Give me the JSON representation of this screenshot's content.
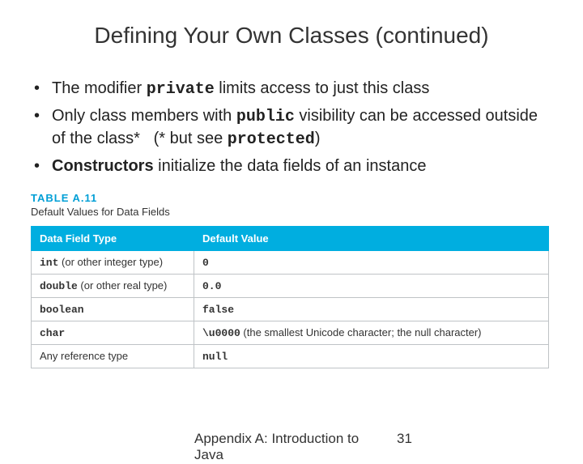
{
  "title": "Defining Your Own Classes (continued)",
  "bullets": {
    "b1a": "The modifier ",
    "b1code": "private",
    "b1b": " limits access to just this class",
    "b2a": "Only class members with ",
    "b2code1": "public",
    "b2b": " visibility can be accessed outside of the class*   (* but see ",
    "b2code2": "protected",
    "b2c": ")",
    "b3bold": "Constructors",
    "b3rest": " initialize the data fields of an instance"
  },
  "table": {
    "label": "TABLE A.11",
    "caption": "Default Values for Data Fields",
    "headers": [
      "Data Field Type",
      "Default Value"
    ],
    "rows": [
      {
        "type_mono": "int",
        "type_rest": " (or other integer type)",
        "value_mono": "0",
        "value_rest": ""
      },
      {
        "type_mono": "double",
        "type_rest": " (or other real type)",
        "value_mono": "0.0",
        "value_rest": ""
      },
      {
        "type_mono": "boolean",
        "type_rest": "",
        "value_mono": "false",
        "value_rest": ""
      },
      {
        "type_mono": "char",
        "type_rest": "",
        "value_mono": "\\u0000",
        "value_rest": " (the smallest Unicode character; the null character)"
      },
      {
        "type_mono": "",
        "type_rest": "Any reference type",
        "value_mono": "null",
        "value_rest": ""
      }
    ]
  },
  "footer": {
    "text": "Appendix A: Introduction to Java",
    "page": "31"
  }
}
